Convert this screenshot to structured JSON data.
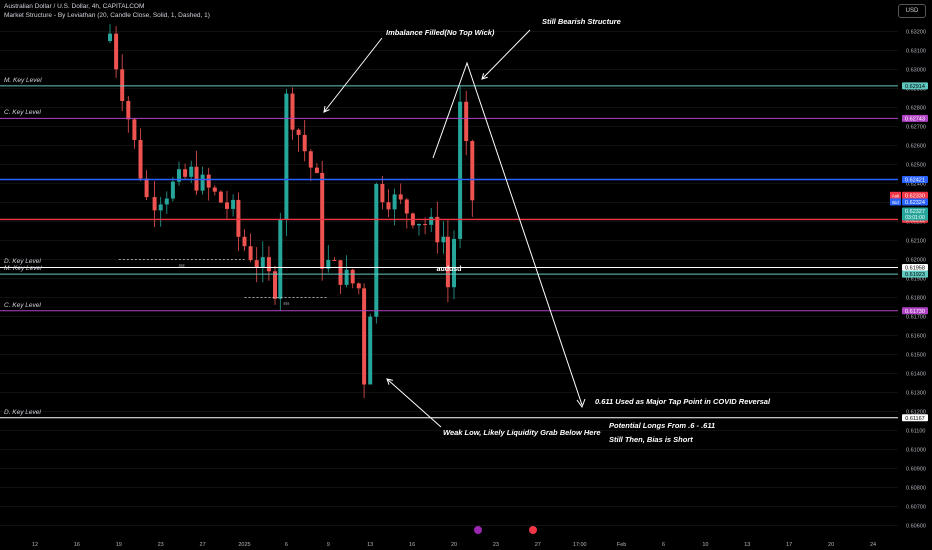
{
  "header": {
    "symbol_line": "Australian Dollar / U.S. Dollar, 4h, CAPITALCOM",
    "indicator_line": "Market Structure - By Leviathan (20, Candle Close, Solid, 1, Dashed, 1)",
    "currency_button": "USD"
  },
  "colors": {
    "background": "#000000",
    "bull": "#26a69a",
    "bear": "#ef5350",
    "m_key": "#5fc9c0",
    "c_key": "#b043c4",
    "d_key": "#ffffff",
    "blue_line": "#2962ff",
    "red_line": "#f23645"
  },
  "chart_data": {
    "type": "candlestick",
    "symbol": "AUDUSD",
    "ylim": [
      0.6055,
      0.6325
    ],
    "y_ticks": [
      "0.63200",
      "0.63100",
      "0.63000",
      "0.62900",
      "0.62800",
      "0.62700",
      "0.62600",
      "0.62500",
      "0.62400",
      "0.62300",
      "0.62200",
      "0.62100",
      "0.62000",
      "0.61900",
      "0.61800",
      "0.61700",
      "0.61600",
      "0.61500",
      "0.61400",
      "0.61300",
      "0.61200",
      "0.61100",
      "0.61000",
      "0.60900",
      "0.60800",
      "0.60700",
      "0.60600"
    ],
    "x_ticks": [
      "12",
      "16",
      "19",
      "23",
      "27",
      "2025",
      "6",
      "9",
      "13",
      "16",
      "20",
      "23",
      "27",
      "17:00",
      "Feb",
      "6",
      "10",
      "13",
      "17",
      "20",
      "24"
    ],
    "levels": [
      {
        "label": "M. Key Level",
        "value": 0.62914,
        "tag": "0.62914",
        "kind": "m_key"
      },
      {
        "label": "C. Key Level",
        "value": 0.62743,
        "tag": "0.62743",
        "kind": "c_key"
      },
      {
        "label": "D. Key Level",
        "value": 0.61958,
        "tag": "0.61958",
        "kind": "d_key"
      },
      {
        "label": "M. Key Level",
        "value": 0.61923,
        "tag": "0.61923",
        "kind": "m_key"
      },
      {
        "label": "C. Key Level",
        "value": 0.6173,
        "tag": "0.61730",
        "kind": "c_key"
      },
      {
        "label": "D. Key Level",
        "value": 0.61167,
        "tag": "0.61167",
        "kind": "d_key"
      }
    ],
    "blue_line": {
      "value": 0.62421,
      "tag": "0.62421"
    },
    "red_line": {
      "value": 0.62211,
      "tag": "0.62211"
    },
    "ask": {
      "label": "Ask",
      "value": 0.6233,
      "tag": "0.62330"
    },
    "bid": {
      "label": "Bid",
      "value": 0.62324,
      "tag": "0.62324"
    },
    "last": {
      "value": 0.62327,
      "tag": "0.62327",
      "countdown": "03:01:00"
    },
    "symbol_label": "audusd",
    "dashed_lows": [
      {
        "from": "19",
        "to": "2025",
        "value": 0.62,
        "tag": "sss"
      },
      {
        "from": "2025",
        "to": "9",
        "value": 0.618,
        "tag": "sss"
      }
    ],
    "anchors": [
      {
        "t": "19",
        "open": 0.6315,
        "close": 0.6319
      },
      {
        "t": "19",
        "open": 0.6318,
        "close": 0.6232
      },
      {
        "t": "23",
        "open": 0.623,
        "close": 0.6245
      },
      {
        "t": "27",
        "open": 0.6245,
        "close": 0.6225
      },
      {
        "t": "2025",
        "open": 0.6225,
        "close": 0.6212
      },
      {
        "t": "2025",
        "open": 0.6212,
        "close": 0.6186
      },
      {
        "t": "6",
        "open": 0.6186,
        "close": 0.6225
      },
      {
        "t": "6",
        "open": 0.6225,
        "close": 0.6284
      },
      {
        "t": "6",
        "open": 0.6284,
        "close": 0.624
      },
      {
        "t": "9",
        "open": 0.624,
        "close": 0.62
      },
      {
        "t": "9",
        "open": 0.62,
        "close": 0.6185
      },
      {
        "t": "13",
        "open": 0.6185,
        "close": 0.6138
      },
      {
        "t": "13",
        "open": 0.6138,
        "close": 0.6175
      },
      {
        "t": "16",
        "open": 0.6175,
        "close": 0.6238
      },
      {
        "t": "16",
        "open": 0.6238,
        "close": 0.6212
      },
      {
        "t": "20",
        "open": 0.6212,
        "close": 0.6186
      },
      {
        "t": "20",
        "open": 0.6186,
        "close": 0.6212
      },
      {
        "t": "20",
        "open": 0.6212,
        "close": 0.6279
      },
      {
        "t": "20",
        "open": 0.6279,
        "close": 0.6232
      }
    ],
    "annotations": [
      "Imbalance Filled(No Top Wick)",
      "Still Bearish Structure",
      "Weak Low, Likely Liquidity Grab Below Here",
      "0.611 Used as Major Tap Point in COVID Reversal",
      "Potential Longs From .6 - .611",
      "Still Then, Bias is Short"
    ]
  }
}
